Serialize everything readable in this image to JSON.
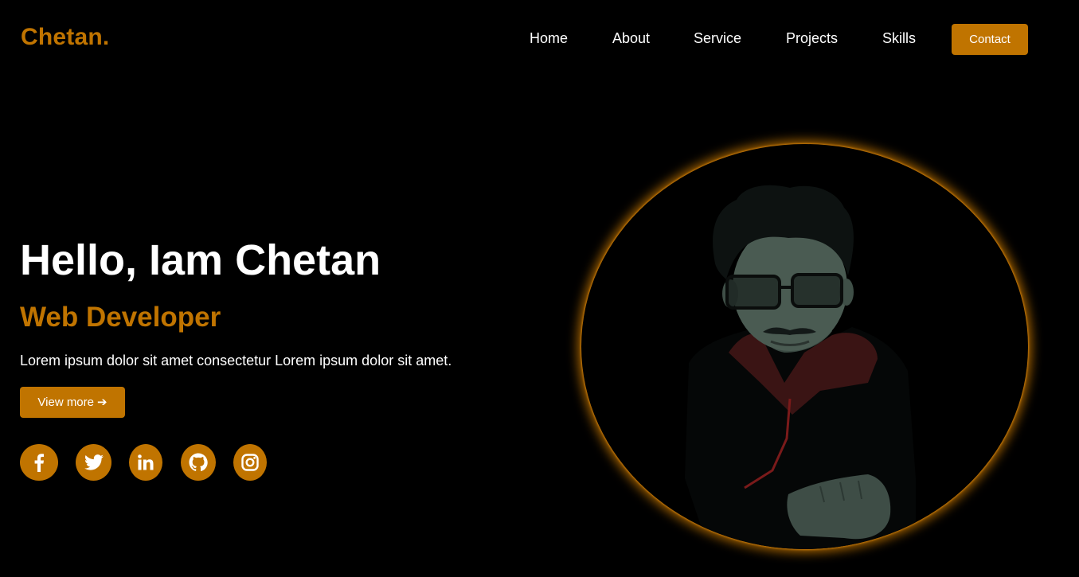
{
  "brand": {
    "logo": "Chetan.",
    "accent_color": "#c07400",
    "background_color": "#000000"
  },
  "nav": {
    "items": [
      {
        "label": "Home"
      },
      {
        "label": "About"
      },
      {
        "label": "Service"
      },
      {
        "label": "Projects"
      },
      {
        "label": "Skills"
      }
    ],
    "contact_label": "Contact"
  },
  "hero": {
    "title": "Hello, Iam Chetan",
    "subtitle": "Web Developer",
    "description": "Lorem ipsum dolor sit amet consectetur Lorem ipsum dolor sit amet.",
    "cta_label": "View more",
    "cta_icon": "arrow-right-icon"
  },
  "social": [
    {
      "name": "facebook",
      "icon": "facebook-icon"
    },
    {
      "name": "twitter",
      "icon": "twitter-icon"
    },
    {
      "name": "linkedin",
      "icon": "linkedin-icon"
    },
    {
      "name": "github",
      "icon": "github-icon"
    },
    {
      "name": "instagram",
      "icon": "instagram-icon"
    }
  ],
  "portrait": {
    "glow_color": "#c07400"
  }
}
